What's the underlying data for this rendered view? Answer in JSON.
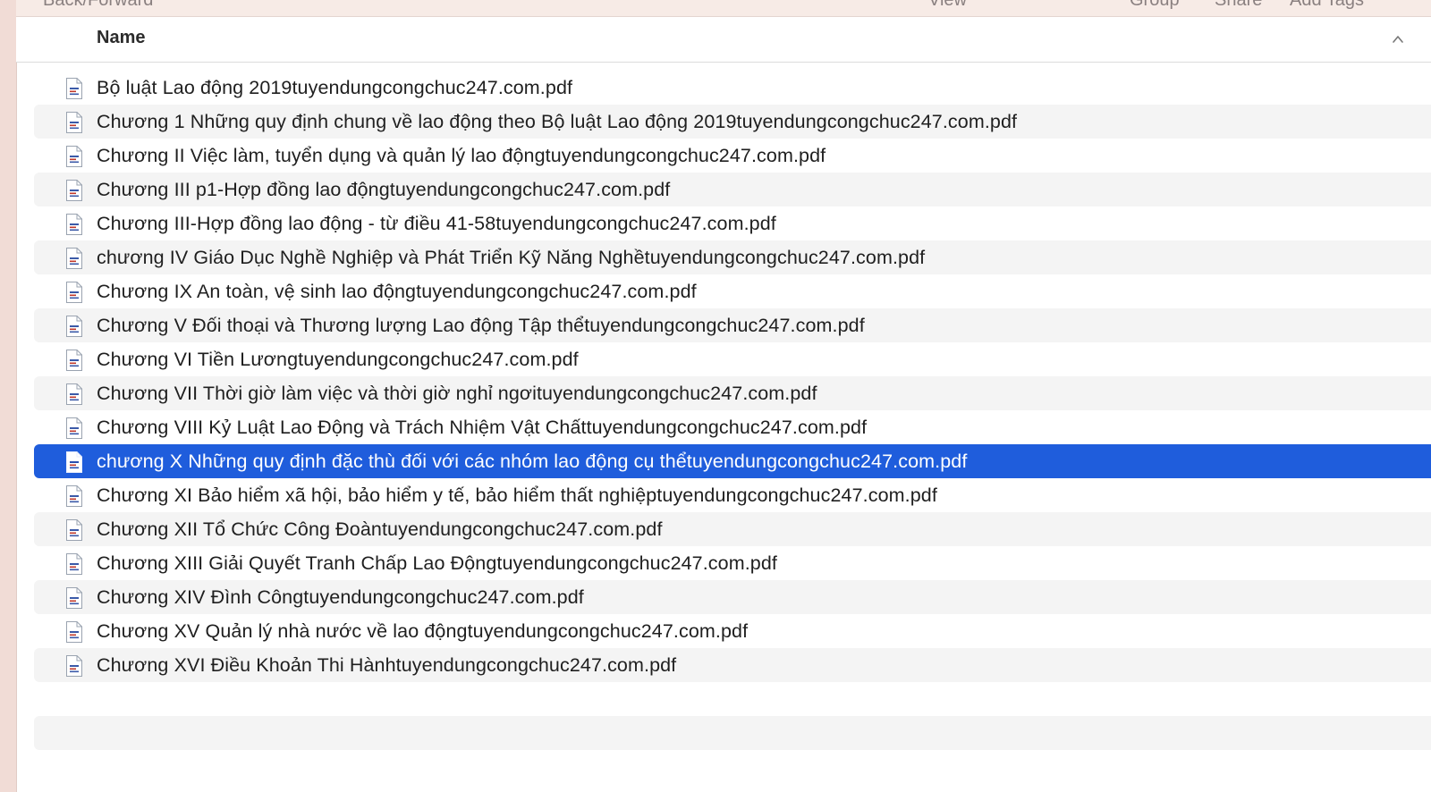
{
  "toolbar": {
    "back_forward": "Back/Forward",
    "view": "View",
    "group": "Group",
    "share": "Share",
    "add_tags": "Add Tags"
  },
  "header": {
    "name_column": "Name"
  },
  "files": [
    {
      "name": "Bộ luật Lao động 2019tuyendungcongchuc247.com.pdf",
      "selected": false
    },
    {
      "name": "Chương 1 Những quy định chung về lao động theo Bộ luật Lao động 2019tuyendungcongchuc247.com.pdf",
      "selected": false
    },
    {
      "name": "Chương II Việc làm, tuyển dụng và quản lý lao độngtuyendungcongchuc247.com.pdf",
      "selected": false
    },
    {
      "name": "Chương III p1-Hợp đồng lao độngtuyendungcongchuc247.com.pdf",
      "selected": false
    },
    {
      "name": "Chương III-Hợp đồng lao động - từ điều 41-58tuyendungcongchuc247.com.pdf",
      "selected": false
    },
    {
      "name": "chương IV Giáo Dục Nghề Nghiệp và Phát Triển Kỹ Năng Nghềtuyendungcongchuc247.com.pdf",
      "selected": false
    },
    {
      "name": "Chương IX An toàn, vệ sinh lao độngtuyendungcongchuc247.com.pdf",
      "selected": false
    },
    {
      "name": "Chương V Đối thoại và Thương lượng Lao động Tập thểtuyendungcongchuc247.com.pdf",
      "selected": false
    },
    {
      "name": "Chương VI Tiền Lươngtuyendungcongchuc247.com.pdf",
      "selected": false
    },
    {
      "name": "Chương VII Thời giờ làm việc và thời giờ nghỉ ngơituyendungcongchuc247.com.pdf",
      "selected": false
    },
    {
      "name": "Chương VIII Kỷ Luật Lao Động và Trách Nhiệm Vật Chấttuyendungcongchuc247.com.pdf",
      "selected": false
    },
    {
      "name": "chương X Những quy định đặc thù đối với các nhóm lao động cụ thểtuyendungcongchuc247.com.pdf",
      "selected": true
    },
    {
      "name": "Chương XI Bảo hiểm xã hội, bảo hiểm y tế, bảo hiểm thất nghiệptuyendungcongchuc247.com.pdf",
      "selected": false
    },
    {
      "name": "Chương XII Tổ Chức Công Đoàntuyendungcongchuc247.com.pdf",
      "selected": false
    },
    {
      "name": "Chương XIII Giải Quyết Tranh Chấp Lao Độngtuyendungcongchuc247.com.pdf",
      "selected": false
    },
    {
      "name": "Chương XIV Đình Côngtuyendungcongchuc247.com.pdf",
      "selected": false
    },
    {
      "name": "Chương XV Quản lý nhà nước về lao độngtuyendungcongchuc247.com.pdf",
      "selected": false
    },
    {
      "name": "Chương XVI Điều Khoản Thi Hànhtuyendungcongchuc247.com.pdf",
      "selected": false
    }
  ],
  "colors": {
    "selection": "#1f5ddc",
    "stripe": "#f4f4f4",
    "sidebar": "#f1dcd6"
  },
  "icons": {
    "file": "pdf-document-icon",
    "sort": "chevron-up-icon"
  }
}
